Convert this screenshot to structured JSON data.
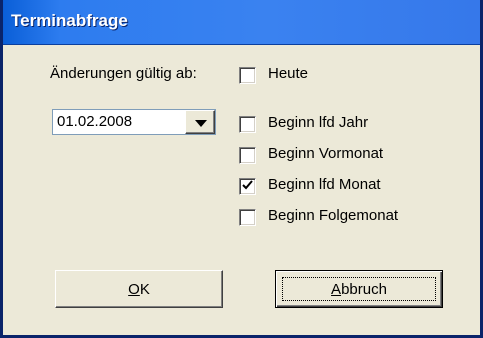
{
  "window": {
    "title": "Terminabfrage"
  },
  "form": {
    "date_label": "Änderungen gültig ab:",
    "date_value": "01.02.2008"
  },
  "checkboxes": [
    {
      "label": "Heute",
      "checked": false
    },
    {
      "label": "Beginn lfd Jahr",
      "checked": false
    },
    {
      "label": "Beginn Vormonat",
      "checked": false
    },
    {
      "label": "Beginn lfd Monat",
      "checked": true
    },
    {
      "label": "Beginn Folgemonat",
      "checked": false
    }
  ],
  "buttons": {
    "ok_accel": "O",
    "ok_rest": "K",
    "cancel_accel": "A",
    "cancel_rest": "bbruch"
  },
  "colors": {
    "titlebar": "#3a82f0",
    "dialog_bg": "#ece9d8",
    "border": "#0a246a"
  }
}
